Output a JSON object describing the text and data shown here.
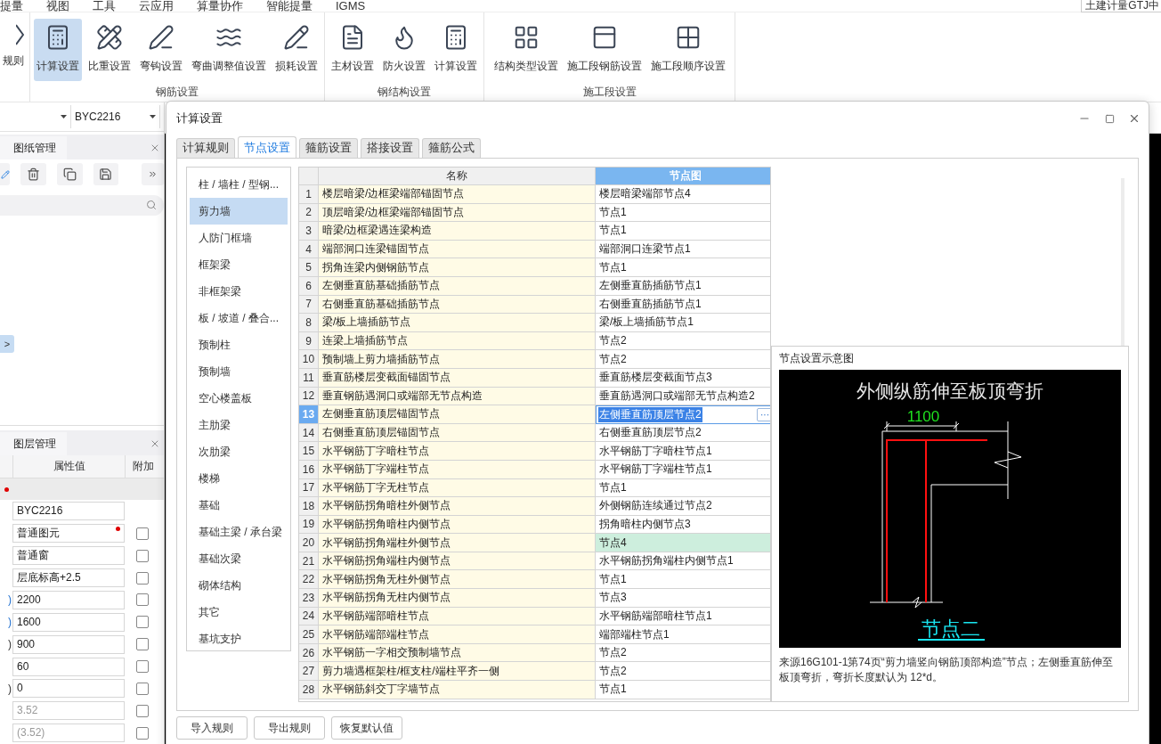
{
  "menu_bar": {
    "items": [
      "提量",
      "视图",
      "工具",
      "云应用",
      "算量协作",
      "智能提量",
      "IGMS"
    ],
    "product_tab": "土建计量GTJ中"
  },
  "ribbon": {
    "partial_button": {
      "label": "规则"
    },
    "groups": [
      {
        "title": "钢筋设置",
        "buttons": [
          {
            "label": "计算设置",
            "selected": true
          },
          {
            "label": "比重设置",
            "selected": false
          },
          {
            "label": "弯钩设置",
            "selected": false
          },
          {
            "label": "弯曲调整值设置",
            "selected": false
          },
          {
            "label": "损耗设置",
            "selected": false
          }
        ]
      },
      {
        "title": "钢结构设置",
        "buttons": [
          {
            "label": "主材设置",
            "selected": false
          },
          {
            "label": "防火设置",
            "selected": false
          },
          {
            "label": "计算设置",
            "selected": false
          }
        ]
      },
      {
        "title": "施工段设置",
        "buttons": [
          {
            "label": "结构类型设置",
            "selected": false
          },
          {
            "label": "施工段钢筋设置",
            "selected": false
          },
          {
            "label": "施工段顺序设置",
            "selected": false
          }
        ]
      }
    ]
  },
  "side_panel": {
    "dropdown_value": "BYC2216",
    "drawings_tab": "图纸管理",
    "expand_button": ">",
    "layers_tab": "图层管理",
    "columns": [
      "属性值",
      "附加"
    ],
    "properties": [
      {
        "kind": "section",
        "flag": true
      },
      {
        "kind": "plain",
        "value": "BYC2216"
      },
      {
        "kind": "check",
        "value": "普通图元",
        "flag": true,
        "checked": false,
        "muted": false
      },
      {
        "kind": "check",
        "value": "普通窗",
        "checked": false,
        "muted": false
      },
      {
        "kind": "check",
        "value": "层底标高+2.5",
        "checked": false,
        "muted": false
      },
      {
        "kind": "check",
        "label": ")",
        "accent": true,
        "value": "2200",
        "checked": false,
        "muted": false
      },
      {
        "kind": "check",
        "label": ")",
        "accent": true,
        "value": "1600",
        "checked": false,
        "muted": false
      },
      {
        "kind": "check",
        "label": ")",
        "accent": false,
        "value": "900",
        "checked": false,
        "muted": false
      },
      {
        "kind": "check",
        "value": "60",
        "checked": false,
        "muted": false
      },
      {
        "kind": "check",
        "label": ")",
        "accent": false,
        "value": "0",
        "checked": false,
        "muted": false
      },
      {
        "kind": "check",
        "value": "3.52",
        "checked": false,
        "muted": true
      },
      {
        "kind": "check",
        "value": "(3.52)",
        "checked": false,
        "muted": true
      }
    ]
  },
  "dialog": {
    "title": "计算设置",
    "tabs": [
      {
        "label": "计算规则",
        "selected": false
      },
      {
        "label": "节点设置",
        "selected": true
      },
      {
        "label": "箍筋设置",
        "selected": false
      },
      {
        "label": "搭接设置",
        "selected": false
      },
      {
        "label": "箍筋公式",
        "selected": false
      }
    ],
    "categories": [
      {
        "label": "柱 / 墙柱 / 型钢...",
        "selected": false
      },
      {
        "label": "剪力墙",
        "selected": true
      },
      {
        "label": "人防门框墙",
        "selected": false
      },
      {
        "label": "框架梁",
        "selected": false
      },
      {
        "label": "非框架梁",
        "selected": false
      },
      {
        "label": "板 / 坡道 / 叠合...",
        "selected": false
      },
      {
        "label": "预制柱",
        "selected": false
      },
      {
        "label": "预制墙",
        "selected": false
      },
      {
        "label": "空心楼盖板",
        "selected": false
      },
      {
        "label": "主肋梁",
        "selected": false
      },
      {
        "label": "次肋梁",
        "selected": false
      },
      {
        "label": "楼梯",
        "selected": false
      },
      {
        "label": "基础",
        "selected": false
      },
      {
        "label": "基础主梁 / 承台梁",
        "selected": false
      },
      {
        "label": "基础次梁",
        "selected": false
      },
      {
        "label": "砌体结构",
        "selected": false
      },
      {
        "label": "其它",
        "selected": false
      },
      {
        "label": "基坑支护",
        "selected": false
      }
    ],
    "table": {
      "columns": [
        {
          "label": "名称",
          "selected": false
        },
        {
          "label": "节点图",
          "selected": true
        }
      ],
      "edit_button": "···",
      "rows": [
        {
          "number": "1",
          "name": "楼层暗梁/边框梁端部锚固节点",
          "node": "楼层暗梁端部节点4",
          "selected": false
        },
        {
          "number": "2",
          "name": "顶层暗梁/边框梁端部锚固节点",
          "node": "节点1",
          "selected": false
        },
        {
          "number": "3",
          "name": "暗梁/边框梁遇连梁构造",
          "node": "节点1",
          "selected": false
        },
        {
          "number": "4",
          "name": "端部洞口连梁锚固节点",
          "node": "端部洞口连梁节点1",
          "selected": false
        },
        {
          "number": "5",
          "name": "拐角连梁内侧钢筋节点",
          "node": "节点1",
          "selected": false
        },
        {
          "number": "6",
          "name": "左侧垂直筋基础插筋节点",
          "node": "左侧垂直筋插筋节点1",
          "selected": false
        },
        {
          "number": "7",
          "name": "右侧垂直筋基础插筋节点",
          "node": "右侧垂直筋插筋节点1",
          "selected": false
        },
        {
          "number": "8",
          "name": "梁/板上墙插筋节点",
          "node": "梁/板上墙插筋节点1",
          "selected": false
        },
        {
          "number": "9",
          "name": "连梁上墙插筋节点",
          "node": "节点2",
          "selected": false
        },
        {
          "number": "10",
          "name": "预制墙上剪力墙插筋节点",
          "node": "节点2",
          "selected": false
        },
        {
          "number": "11",
          "name": "垂直筋楼层变截面锚固节点",
          "node": "垂直筋楼层变截面节点3",
          "selected": false
        },
        {
          "number": "12",
          "name": "垂直钢筋遇洞口或端部无节点构造",
          "node": "垂直筋遇洞口或端部无节点构造2",
          "selected": false
        },
        {
          "number": "13",
          "name": "左侧垂直筋顶层锚固节点",
          "node": "左侧垂直筋顶层节点2",
          "selected": true
        },
        {
          "number": "14",
          "name": "右侧垂直筋顶层锚固节点",
          "node": "右侧垂直筋顶层节点2",
          "selected": false
        },
        {
          "number": "15",
          "name": "水平钢筋丁字暗柱节点",
          "node": "水平钢筋丁字暗柱节点1",
          "selected": false
        },
        {
          "number": "16",
          "name": "水平钢筋丁字端柱节点",
          "node": "水平钢筋丁字端柱节点1",
          "selected": false
        },
        {
          "number": "17",
          "name": "水平钢筋丁字无柱节点",
          "node": "节点1",
          "selected": false
        },
        {
          "number": "18",
          "name": "水平钢筋拐角暗柱外侧节点",
          "node": "外侧钢筋连续通过节点2",
          "selected": false
        },
        {
          "number": "19",
          "name": "水平钢筋拐角暗柱内侧节点",
          "node": "拐角暗柱内侧节点3",
          "selected": false
        },
        {
          "number": "20",
          "name": "水平钢筋拐角端柱外侧节点",
          "node": "节点4",
          "selected": false,
          "highlighted": true
        },
        {
          "number": "21",
          "name": "水平钢筋拐角端柱内侧节点",
          "node": "水平钢筋拐角端柱内侧节点1",
          "selected": false
        },
        {
          "number": "22",
          "name": "水平钢筋拐角无柱外侧节点",
          "node": "节点1",
          "selected": false
        },
        {
          "number": "23",
          "name": "水平钢筋拐角无柱内侧节点",
          "node": "节点3",
          "selected": false
        },
        {
          "number": "24",
          "name": "水平钢筋端部暗柱节点",
          "node": "水平钢筋端部暗柱节点1",
          "selected": false
        },
        {
          "number": "25",
          "name": "水平钢筋端部端柱节点",
          "node": "端部端柱节点1",
          "selected": false
        },
        {
          "number": "26",
          "name": "水平钢筋一字相交预制墙节点",
          "node": "节点2",
          "selected": false
        },
        {
          "number": "27",
          "name": "剪力墙遇框架柱/框支柱/端柱平齐一侧",
          "node": "节点2",
          "selected": false
        },
        {
          "number": "28",
          "name": "水平钢筋斜交丁字墙节点",
          "node": "节点1",
          "selected": false
        }
      ]
    },
    "preview": {
      "title": "节点设置示意图",
      "heading": "外侧纵筋伸至板顶弯折",
      "dimension": "1100",
      "node_label": "节点二",
      "caption": "来源16G101-1第74页“剪力墙竖向钢筋顶部构造”节点；左侧垂直筋伸至板顶弯折，弯折长度默认为 12*d。"
    },
    "buttons": [
      "导入规则",
      "导出规则",
      "恢复默认值"
    ]
  }
}
